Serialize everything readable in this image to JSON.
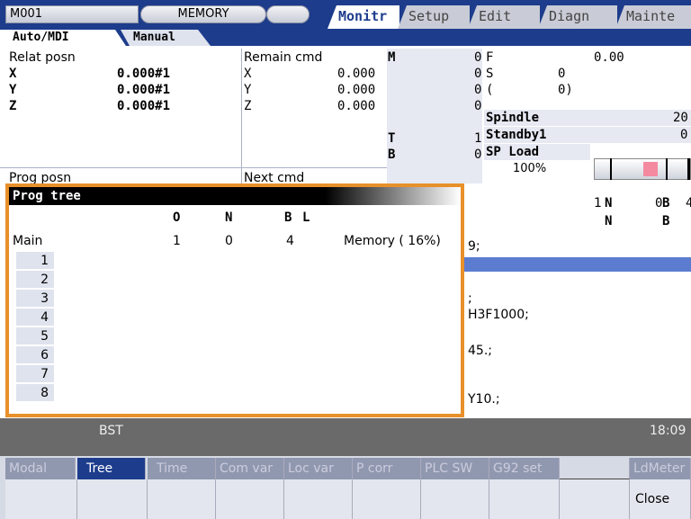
{
  "header": {
    "machine": "M001",
    "mode": "MEMORY",
    "tabs": [
      "Monitr",
      "Setup",
      "Edit",
      "Diagn",
      "Mainte"
    ]
  },
  "subtabs": [
    "Auto/MDI",
    "Manual"
  ],
  "relat_posn": {
    "title": "Relat posn",
    "axes": [
      {
        "axis": "X",
        "value": "0.000#1"
      },
      {
        "axis": "Y",
        "value": "0.000#1"
      },
      {
        "axis": "Z",
        "value": "0.000#1"
      }
    ]
  },
  "remain_cmd": {
    "title": "Remain cmd",
    "axes": [
      {
        "axis": "X",
        "value": "0.000"
      },
      {
        "axis": "Y",
        "value": "0.000"
      },
      {
        "axis": "Z",
        "value": "0.000"
      }
    ]
  },
  "prog_posn_title": "Prog posn",
  "next_cmd_title": "Next cmd",
  "mstb": {
    "m": {
      "label": "M",
      "value": "0"
    },
    "v1": "0",
    "v2": "0",
    "v3": "0",
    "t": {
      "label": "T",
      "value": "1"
    },
    "b": {
      "label": "B",
      "value": "0"
    }
  },
  "feed": {
    "f_label": "F",
    "f_value": "0.00",
    "s_label": "S",
    "s_value": "0",
    "paren_value": "0)",
    "paren_open": "("
  },
  "spindle": {
    "spindle_label": "Spindle",
    "spindle_value": "20",
    "standby_label": "Standby1",
    "standby_value": "0",
    "load_label": "SP Load",
    "load_percent": "100%",
    "load_fraction": 1.0
  },
  "nb_area": {
    "row1_left": "1",
    "n1": "N",
    "n1_val": "0",
    "b1": "B",
    "b1_val": "4",
    "n2": "N",
    "b2": "B"
  },
  "program_lines": [
    "9;",
    "",
    ";",
    "H3F1000;",
    "45.;",
    "",
    "Y10.;"
  ],
  "tree": {
    "title": "Prog tree",
    "columns": [
      "O",
      "N",
      "B",
      "L"
    ],
    "main": {
      "label": "Main",
      "o": "1",
      "n": "0",
      "b": "4",
      "memory": "Memory ( 16%)"
    },
    "levels": [
      "1",
      "2",
      "3",
      "4",
      "5",
      "6",
      "7",
      "8"
    ]
  },
  "status": {
    "left": "BST",
    "time": "18:09"
  },
  "softkeys": [
    {
      "label": "Modal",
      "active": false
    },
    {
      "label": "Tree",
      "active": true
    },
    {
      "label": "Time",
      "active": false
    },
    {
      "label": "Com var",
      "active": false
    },
    {
      "label": "Loc var",
      "active": false
    },
    {
      "label": "P corr",
      "active": false
    },
    {
      "label": "PLC SW",
      "active": false
    },
    {
      "label": "G92 set",
      "active": false
    },
    {
      "label": "",
      "active": false
    },
    {
      "label": "LdMeter",
      "active": false
    }
  ],
  "close_label": "Close",
  "colors": {
    "header_blue": "#1d3c8c",
    "tree_border": "#e8902a",
    "status_gray": "#6a6a6a"
  }
}
